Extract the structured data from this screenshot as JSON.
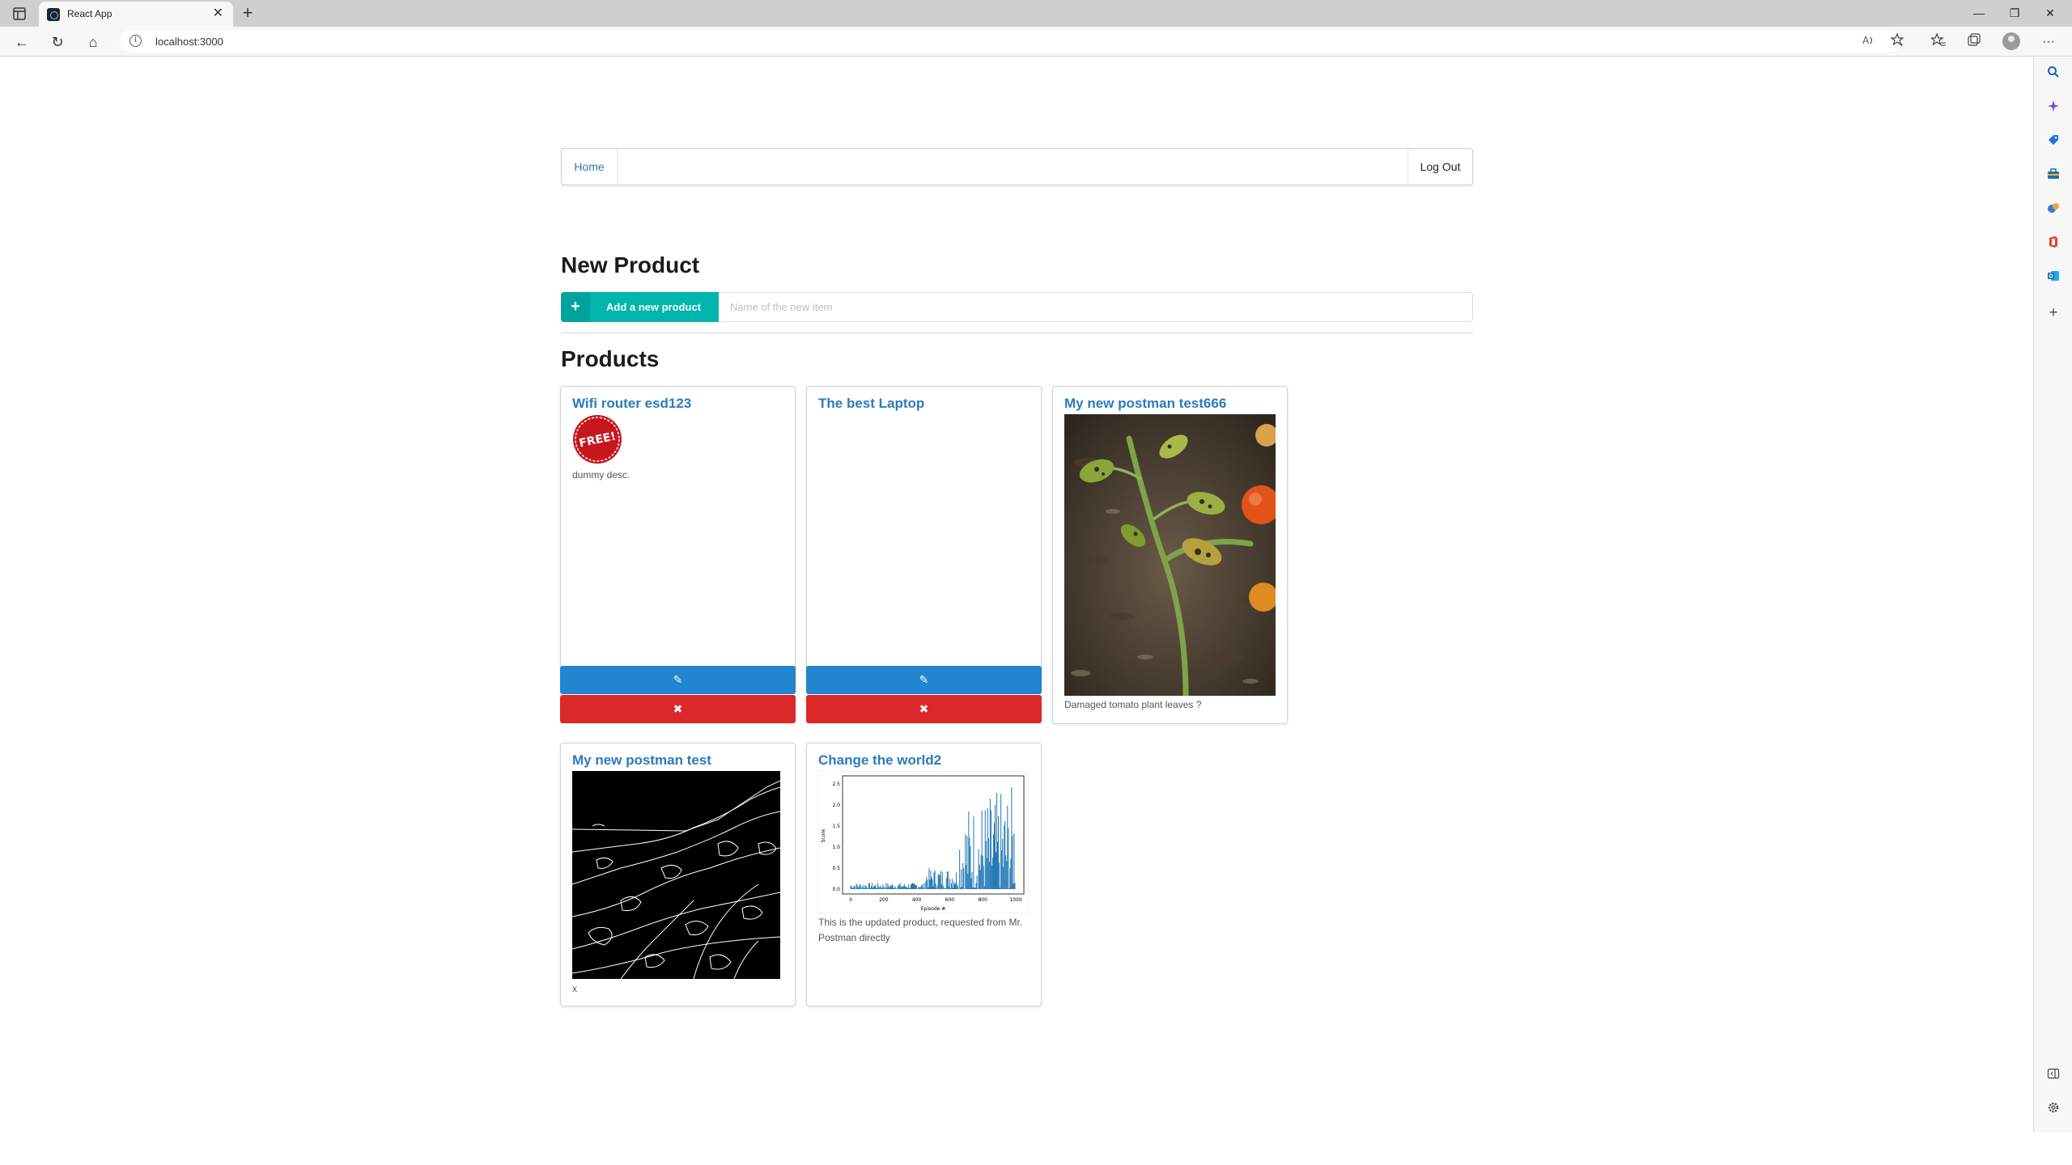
{
  "browser": {
    "tab_title": "React App",
    "tab_close": "✕",
    "new_tab": "+",
    "url": "localhost:3000",
    "url_info": "i",
    "win_min": "—",
    "win_restore": "❐",
    "win_close": "✕",
    "back": "←",
    "reload": "↻",
    "home": "⌂",
    "menu_dots": "···"
  },
  "nav": {
    "home_label": "Home",
    "logout_label": "Log Out"
  },
  "new_product": {
    "title": "New Product",
    "add_button_icon": "+",
    "add_button_label": "Add a new product",
    "input_placeholder": "Name of the new item",
    "input_value": ""
  },
  "products": {
    "title": "Products",
    "items": [
      {
        "name": "Wifi router esd123",
        "description": "dummy desc.",
        "image": "free-badge",
        "badge_text": "FREE!",
        "edit_icon": "✎",
        "delete_icon": "✖"
      },
      {
        "name": "The best Laptop",
        "description": "",
        "image": "none",
        "edit_icon": "✎",
        "delete_icon": "✖"
      },
      {
        "name": "My new postman test666",
        "description": "Damaged tomato plant leaves ?",
        "image": "tomato-plant-photo"
      },
      {
        "name": "My new postman test",
        "description": "x",
        "image": "edge-detection-image"
      },
      {
        "name": "Change the world2",
        "description": "This is the updated product, requested from Mr. Postman directly",
        "image": "score-chart-image",
        "chart": {
          "ylabel": "Score",
          "xlabel": "Episode #",
          "yticks": [
            "0.0",
            "0.5",
            "1.0",
            "1.5",
            "2.0",
            "2.5"
          ],
          "xticks": [
            "0",
            "200",
            "400",
            "600",
            "800",
            "1000"
          ]
        }
      }
    ]
  },
  "colors": {
    "accent_teal": "#00b5ad",
    "edit_blue": "#2185d0",
    "delete_red": "#db2828",
    "link_blue": "#2b7bbd"
  }
}
